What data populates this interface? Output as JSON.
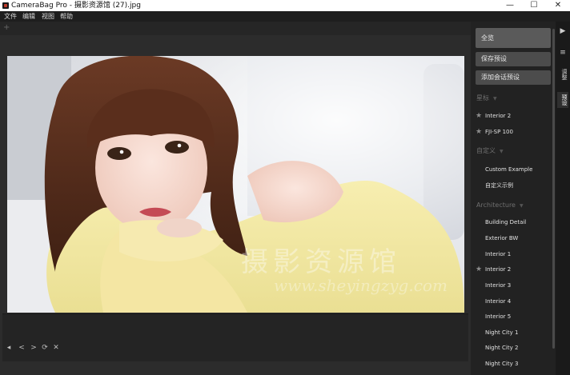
{
  "window": {
    "title": "CameraBag Pro - 摄影资源馆 (27).jpg",
    "minimize": "—",
    "maximize": "☐",
    "close": "✕"
  },
  "menu": [
    "文件",
    "编辑",
    "视图",
    "帮助"
  ],
  "workspace": {
    "add_glyph": "+",
    "watermark_text": "摄影资源馆",
    "watermark_url": "www.sheyingzyg.com"
  },
  "bottom_tools": [
    "◂",
    "<",
    ">",
    "⟳",
    "✕"
  ],
  "panel": {
    "buttons": {
      "all": "全览",
      "save_preset": "保存预设",
      "add_session_preset": "添加会话预设"
    },
    "sections": {
      "star": {
        "title": "星标",
        "items": [
          "Interior 2",
          "FJI-SP 100"
        ]
      },
      "custom": {
        "title": "自定义",
        "items": [
          "Custom Example",
          "自定义示例"
        ]
      },
      "architecture": {
        "title": "Architecture",
        "items": [
          {
            "label": "Building Detail",
            "starred": false
          },
          {
            "label": "Exterior BW",
            "starred": false
          },
          {
            "label": "Interior 1",
            "starred": false
          },
          {
            "label": "Interior 2",
            "starred": true
          },
          {
            "label": "Interior 3",
            "starred": false
          },
          {
            "label": "Interior 4",
            "starred": false
          },
          {
            "label": "Interior 5",
            "starred": false
          },
          {
            "label": "Night City 1",
            "starred": false
          },
          {
            "label": "Night City 2",
            "starred": false
          },
          {
            "label": "Night City 3",
            "starred": false
          }
        ]
      }
    },
    "star_glyph": "★",
    "caret_glyph": "▼"
  },
  "sidetabs": {
    "play_glyph": "▶",
    "menu_glyph": "≡",
    "tabs": [
      "调整",
      "预设"
    ]
  }
}
